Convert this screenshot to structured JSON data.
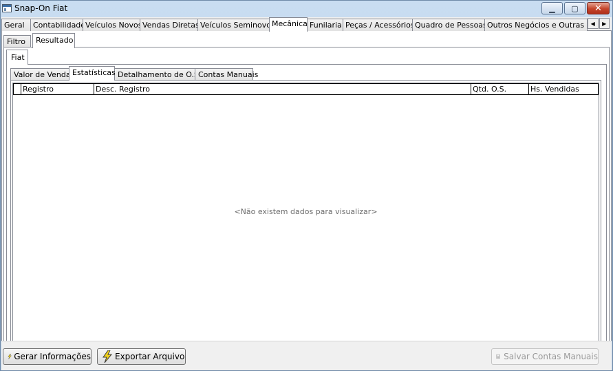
{
  "window": {
    "title": "Snap-On Fiat"
  },
  "top_tabs": [
    {
      "label": "Geral"
    },
    {
      "label": "Contabilidade"
    },
    {
      "label": "Veículos Novos"
    },
    {
      "label": "Vendas Diretas"
    },
    {
      "label": "Veículos Seminovos"
    },
    {
      "label": "Mecânica"
    },
    {
      "label": "Funilaria"
    },
    {
      "label": "Peças / Acessórios"
    },
    {
      "label": "Quadro de Pessoas"
    },
    {
      "label": "Outros Negócios e Outras Mar"
    }
  ],
  "top_tabs_active": "Mecânica",
  "sub_tabs": [
    {
      "label": "Filtro"
    },
    {
      "label": "Resultado"
    }
  ],
  "sub_tabs_active": "Resultado",
  "brand_tab": {
    "label": "Fiat"
  },
  "inner_tabs": [
    {
      "label": "Valor de Vendas"
    },
    {
      "label": "Estatísticas"
    },
    {
      "label": "Detalhamento de O.S."
    },
    {
      "label": "Contas Manuais"
    }
  ],
  "inner_tabs_active": "Estatísticas",
  "grid": {
    "columns": [
      "Registro",
      "Desc. Registro",
      "Qtd. O.S.",
      "Hs. Vendidas"
    ],
    "rows": [],
    "empty_message": "<Não existem dados para visualizar>"
  },
  "buttons": {
    "generate": "Gerar Informações",
    "export": "Exportar Arquivo",
    "save_manual": "Salvar Contas Manuais"
  },
  "icons": {
    "generate": "lightning-icon",
    "export": "lightning-icon",
    "save_manual": "floppy-disk-icon"
  },
  "colors": {
    "title_bar": "#c9ddf1",
    "close_button": "#c4452b",
    "window_face": "#f0f0f0",
    "lightning": "#f2d21a"
  }
}
